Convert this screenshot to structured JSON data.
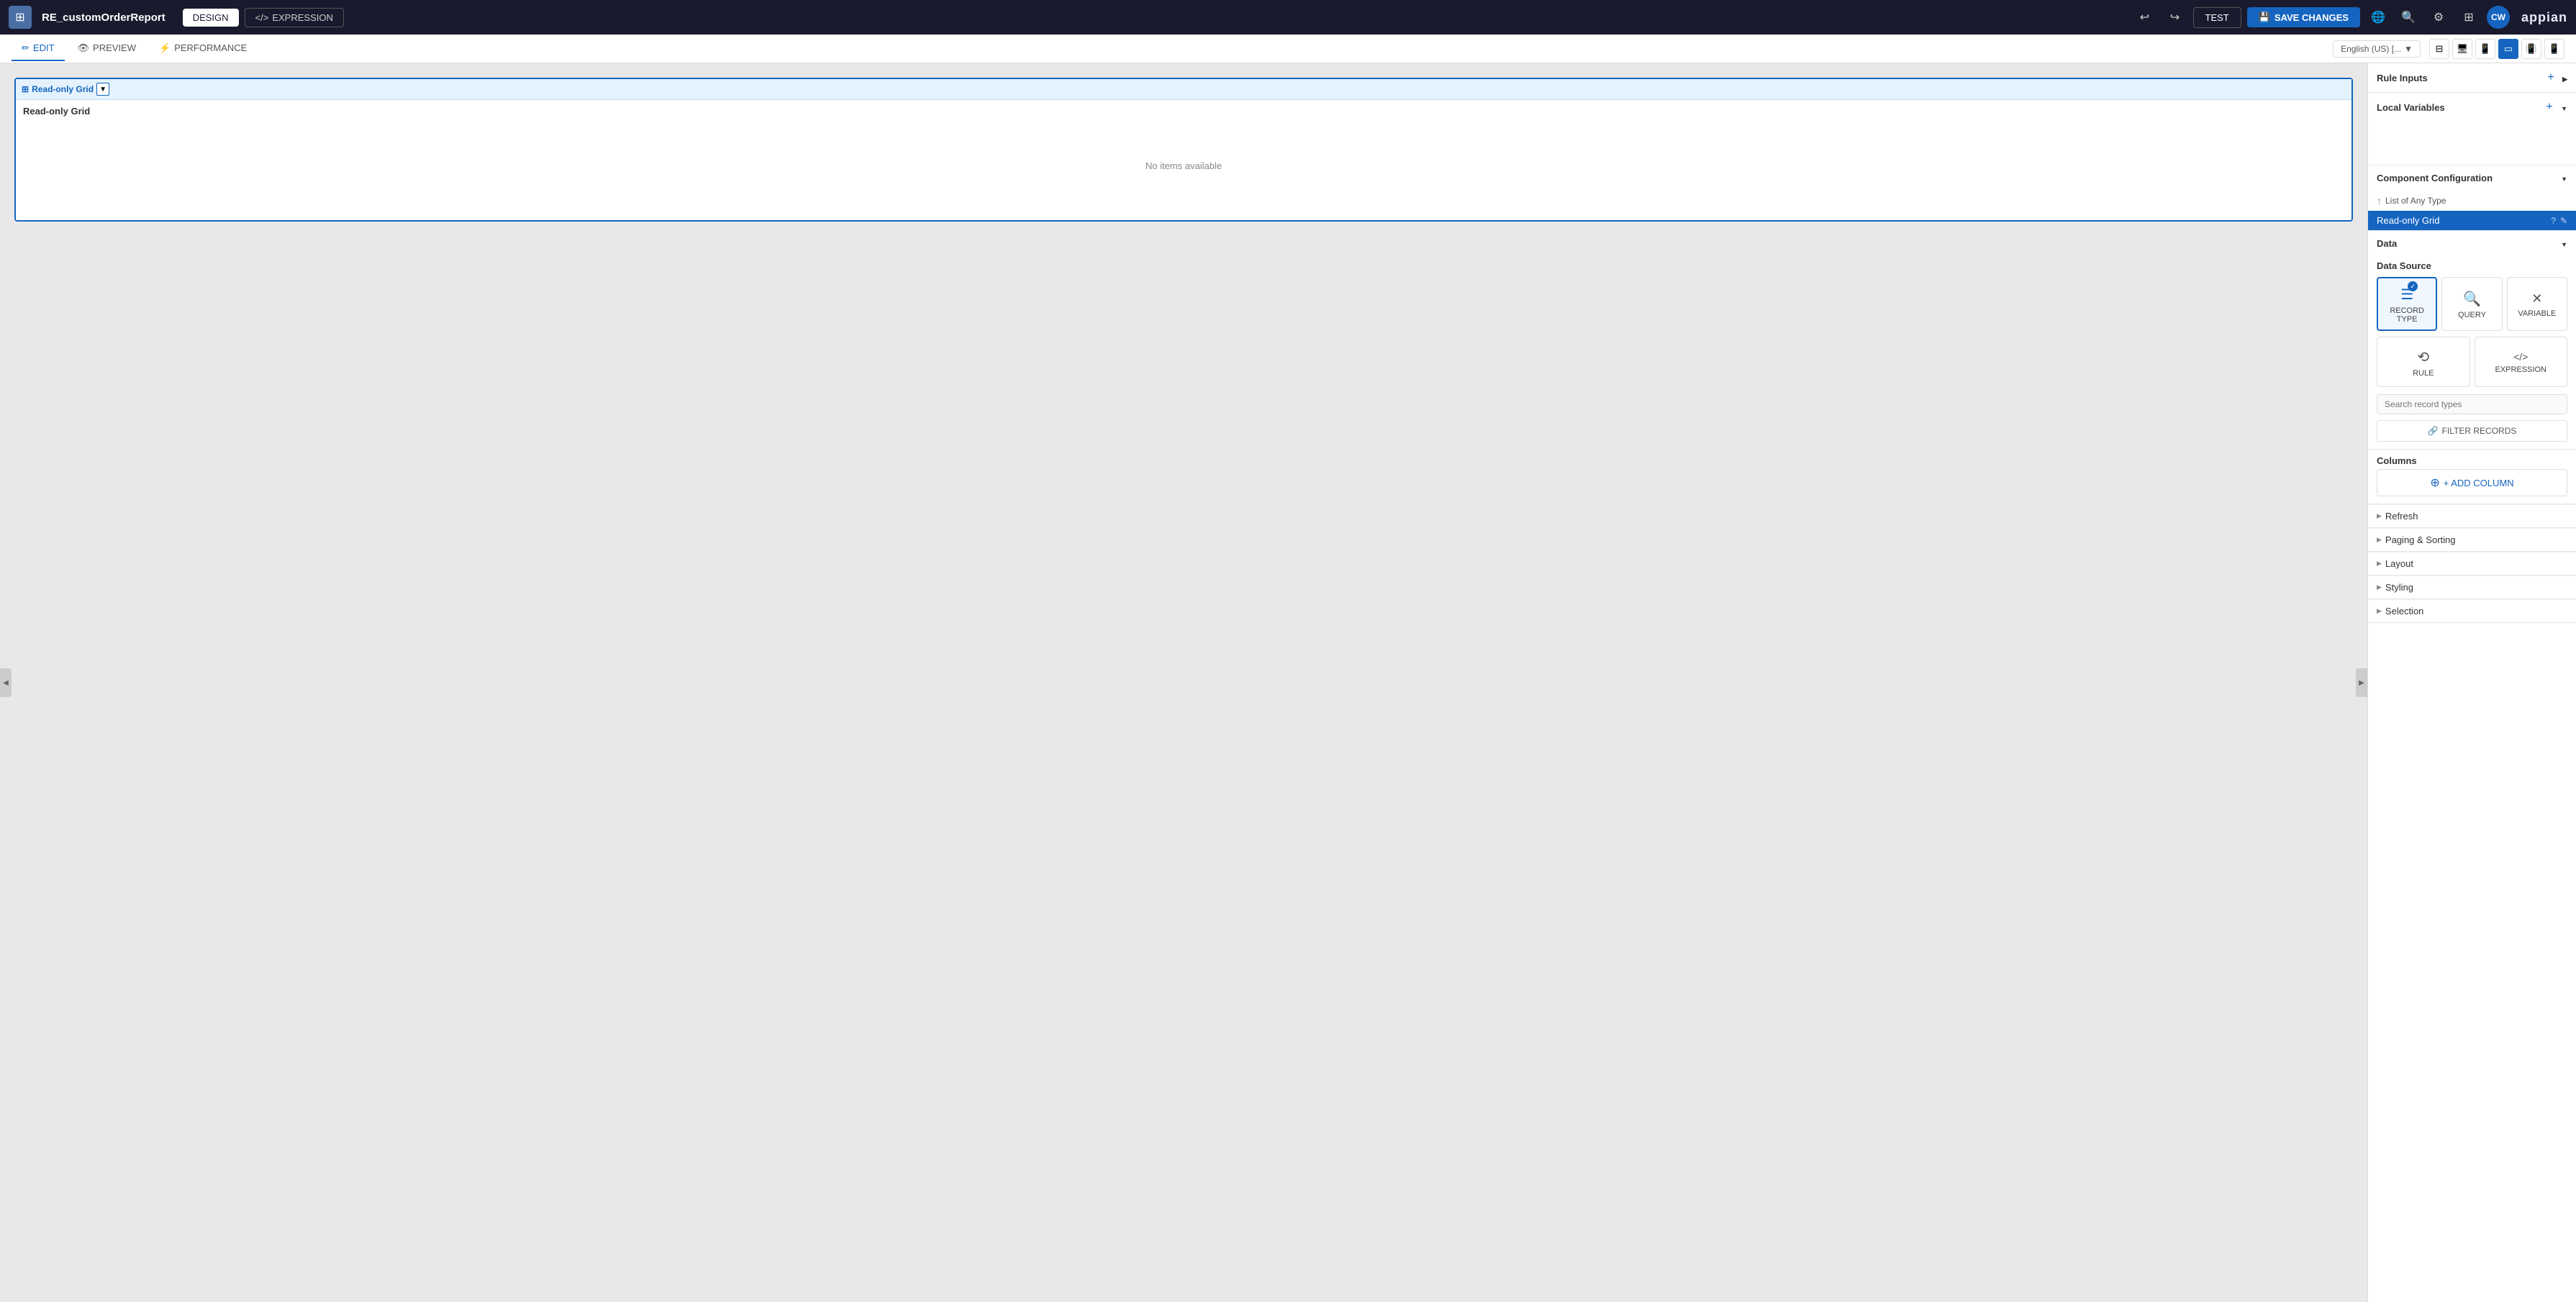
{
  "app": {
    "title": "RE_customOrderReport",
    "icon": "⊞"
  },
  "topnav": {
    "design_label": "DESIGN",
    "expression_label": "EXPRESSION",
    "test_label": "TEST",
    "save_label": "SAVE CHANGES",
    "avatar_label": "CW",
    "appian_label": "appian"
  },
  "secondnav": {
    "tabs": [
      {
        "label": "EDIT",
        "icon": "✏",
        "active": true
      },
      {
        "label": "PREVIEW",
        "icon": "👁",
        "active": false
      },
      {
        "label": "PERFORMANCE",
        "icon": "⚡",
        "active": false
      }
    ],
    "language": "English (US) [..."
  },
  "canvas": {
    "grid_label": "Read-only Grid",
    "grid_title": "Read-only Grid",
    "empty_message": "No items available",
    "expand_left": "❮",
    "expand_right": "❯"
  },
  "rightpanel": {
    "rule_inputs_label": "Rule Inputs",
    "local_variables_label": "Local Variables",
    "component_config_label": "Component Configuration",
    "list_of_any_label": "List of Any Type",
    "readonly_grid_label": "Read-only Grid",
    "data_label": "Data",
    "datasource_label": "Data Source",
    "datasource_options": [
      {
        "id": "record_type",
        "label": "RECORD TYPE",
        "icon": "☰",
        "selected": true
      },
      {
        "id": "query",
        "label": "QUERY",
        "icon": "🔍",
        "selected": false
      },
      {
        "id": "variable",
        "label": "VARIABLE",
        "icon": "✕",
        "selected": false
      },
      {
        "id": "rule",
        "label": "RULE",
        "icon": "⟲",
        "selected": false
      },
      {
        "id": "expression",
        "label": "EXPRESSION",
        "icon": "⟨/⟩",
        "selected": false
      }
    ],
    "search_placeholder": "Search record types",
    "filter_records_label": "FILTER RECORDS",
    "filter_icon": "🔗",
    "columns_label": "Columns",
    "add_column_label": "+ ADD COLUMN",
    "sections": [
      {
        "label": "Refresh",
        "expanded": false
      },
      {
        "label": "Paging & Sorting",
        "expanded": false
      },
      {
        "label": "Layout",
        "expanded": false
      },
      {
        "label": "Styling",
        "expanded": false
      },
      {
        "label": "Selection",
        "expanded": false
      }
    ]
  }
}
